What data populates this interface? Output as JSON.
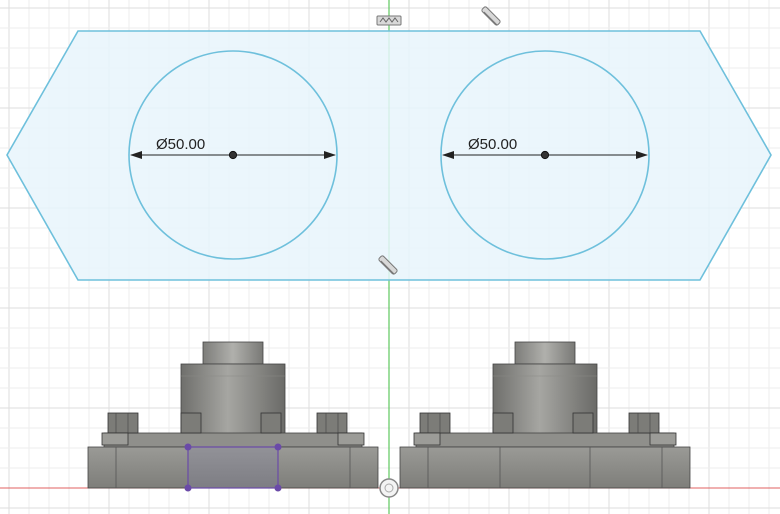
{
  "viewport": {
    "name": "sketch-viewport",
    "colors": {
      "background": "#ffffff",
      "grid_minor": "#eeeeee",
      "grid_major": "#dddddd",
      "y_axis": "#5fc85f",
      "x_axis": "#e06060",
      "sketch_profile_fill": "#e8f4fb",
      "sketch_line": "#6ec0dc",
      "dimension": "#222222",
      "body_dark": "#6b6b68",
      "body_mid": "#8b8b88",
      "body_light": "#a4a4a0",
      "selection": "#6a4aa8"
    }
  },
  "sketch": {
    "dimensions": [
      {
        "label": "Ø50.00"
      },
      {
        "label": "Ø50.00"
      }
    ],
    "constraints": [
      {
        "icon": "horizontal-vertical-constraint-icon"
      },
      {
        "icon": "parallel-constraint-icon"
      },
      {
        "icon": "parallel-constraint-icon"
      }
    ]
  },
  "model": {
    "bodies": [
      {
        "name": "body-left"
      },
      {
        "name": "body-right"
      }
    ]
  }
}
